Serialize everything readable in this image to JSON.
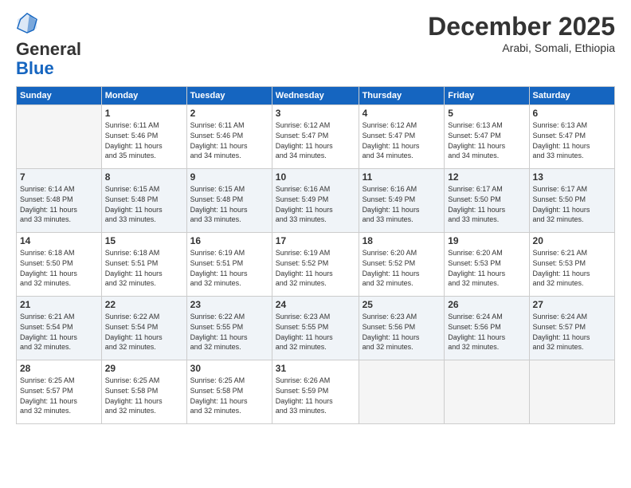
{
  "header": {
    "logo_line1": "General",
    "logo_line2": "Blue",
    "month": "December 2025",
    "location": "Arabi, Somali, Ethiopia"
  },
  "days_of_week": [
    "Sunday",
    "Monday",
    "Tuesday",
    "Wednesday",
    "Thursday",
    "Friday",
    "Saturday"
  ],
  "weeks": [
    [
      {
        "day": "",
        "info": ""
      },
      {
        "day": "1",
        "info": "Sunrise: 6:11 AM\nSunset: 5:46 PM\nDaylight: 11 hours\nand 35 minutes."
      },
      {
        "day": "2",
        "info": "Sunrise: 6:11 AM\nSunset: 5:46 PM\nDaylight: 11 hours\nand 34 minutes."
      },
      {
        "day": "3",
        "info": "Sunrise: 6:12 AM\nSunset: 5:47 PM\nDaylight: 11 hours\nand 34 minutes."
      },
      {
        "day": "4",
        "info": "Sunrise: 6:12 AM\nSunset: 5:47 PM\nDaylight: 11 hours\nand 34 minutes."
      },
      {
        "day": "5",
        "info": "Sunrise: 6:13 AM\nSunset: 5:47 PM\nDaylight: 11 hours\nand 34 minutes."
      },
      {
        "day": "6",
        "info": "Sunrise: 6:13 AM\nSunset: 5:47 PM\nDaylight: 11 hours\nand 33 minutes."
      }
    ],
    [
      {
        "day": "7",
        "info": "Sunrise: 6:14 AM\nSunset: 5:48 PM\nDaylight: 11 hours\nand 33 minutes."
      },
      {
        "day": "8",
        "info": "Sunrise: 6:15 AM\nSunset: 5:48 PM\nDaylight: 11 hours\nand 33 minutes."
      },
      {
        "day": "9",
        "info": "Sunrise: 6:15 AM\nSunset: 5:48 PM\nDaylight: 11 hours\nand 33 minutes."
      },
      {
        "day": "10",
        "info": "Sunrise: 6:16 AM\nSunset: 5:49 PM\nDaylight: 11 hours\nand 33 minutes."
      },
      {
        "day": "11",
        "info": "Sunrise: 6:16 AM\nSunset: 5:49 PM\nDaylight: 11 hours\nand 33 minutes."
      },
      {
        "day": "12",
        "info": "Sunrise: 6:17 AM\nSunset: 5:50 PM\nDaylight: 11 hours\nand 33 minutes."
      },
      {
        "day": "13",
        "info": "Sunrise: 6:17 AM\nSunset: 5:50 PM\nDaylight: 11 hours\nand 32 minutes."
      }
    ],
    [
      {
        "day": "14",
        "info": "Sunrise: 6:18 AM\nSunset: 5:50 PM\nDaylight: 11 hours\nand 32 minutes."
      },
      {
        "day": "15",
        "info": "Sunrise: 6:18 AM\nSunset: 5:51 PM\nDaylight: 11 hours\nand 32 minutes."
      },
      {
        "day": "16",
        "info": "Sunrise: 6:19 AM\nSunset: 5:51 PM\nDaylight: 11 hours\nand 32 minutes."
      },
      {
        "day": "17",
        "info": "Sunrise: 6:19 AM\nSunset: 5:52 PM\nDaylight: 11 hours\nand 32 minutes."
      },
      {
        "day": "18",
        "info": "Sunrise: 6:20 AM\nSunset: 5:52 PM\nDaylight: 11 hours\nand 32 minutes."
      },
      {
        "day": "19",
        "info": "Sunrise: 6:20 AM\nSunset: 5:53 PM\nDaylight: 11 hours\nand 32 minutes."
      },
      {
        "day": "20",
        "info": "Sunrise: 6:21 AM\nSunset: 5:53 PM\nDaylight: 11 hours\nand 32 minutes."
      }
    ],
    [
      {
        "day": "21",
        "info": "Sunrise: 6:21 AM\nSunset: 5:54 PM\nDaylight: 11 hours\nand 32 minutes."
      },
      {
        "day": "22",
        "info": "Sunrise: 6:22 AM\nSunset: 5:54 PM\nDaylight: 11 hours\nand 32 minutes."
      },
      {
        "day": "23",
        "info": "Sunrise: 6:22 AM\nSunset: 5:55 PM\nDaylight: 11 hours\nand 32 minutes."
      },
      {
        "day": "24",
        "info": "Sunrise: 6:23 AM\nSunset: 5:55 PM\nDaylight: 11 hours\nand 32 minutes."
      },
      {
        "day": "25",
        "info": "Sunrise: 6:23 AM\nSunset: 5:56 PM\nDaylight: 11 hours\nand 32 minutes."
      },
      {
        "day": "26",
        "info": "Sunrise: 6:24 AM\nSunset: 5:56 PM\nDaylight: 11 hours\nand 32 minutes."
      },
      {
        "day": "27",
        "info": "Sunrise: 6:24 AM\nSunset: 5:57 PM\nDaylight: 11 hours\nand 32 minutes."
      }
    ],
    [
      {
        "day": "28",
        "info": "Sunrise: 6:25 AM\nSunset: 5:57 PM\nDaylight: 11 hours\nand 32 minutes."
      },
      {
        "day": "29",
        "info": "Sunrise: 6:25 AM\nSunset: 5:58 PM\nDaylight: 11 hours\nand 32 minutes."
      },
      {
        "day": "30",
        "info": "Sunrise: 6:25 AM\nSunset: 5:58 PM\nDaylight: 11 hours\nand 32 minutes."
      },
      {
        "day": "31",
        "info": "Sunrise: 6:26 AM\nSunset: 5:59 PM\nDaylight: 11 hours\nand 33 minutes."
      },
      {
        "day": "",
        "info": ""
      },
      {
        "day": "",
        "info": ""
      },
      {
        "day": "",
        "info": ""
      }
    ]
  ]
}
